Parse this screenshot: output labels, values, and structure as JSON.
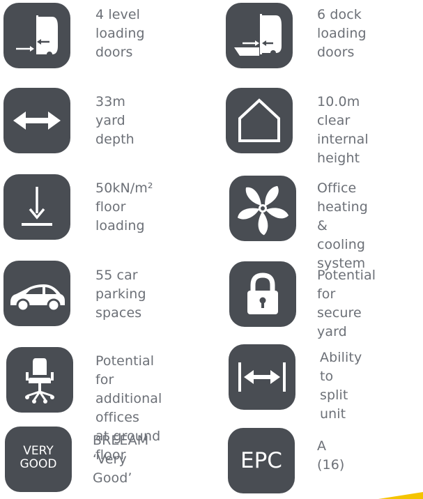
{
  "features": {
    "f1": {
      "label": "4 level\nloading\ndoors",
      "icon": "loading-door-icon"
    },
    "f2": {
      "label": "6 dock\nloading\ndoors",
      "icon": "dock-door-icon"
    },
    "f3": {
      "label": "33m\nyard\ndepth",
      "icon": "double-arrow-icon"
    },
    "f4": {
      "label": "10.0m clear\ninternal\nheight",
      "icon": "house-outline-icon"
    },
    "f5": {
      "label": "50kN/m²\nfloor\nloading",
      "icon": "down-arrow-floor-icon"
    },
    "f6": {
      "label": "Office heating\n& cooling\nsystem",
      "icon": "fan-icon"
    },
    "f7": {
      "label": "55 car\nparking\nspaces",
      "icon": "car-icon"
    },
    "f8": {
      "label": "Potential\nfor secure\nyard",
      "icon": "padlock-icon"
    },
    "f9": {
      "label": "Potential for\nadditional offices\nat ground floor",
      "icon": "office-chair-icon"
    },
    "f10": {
      "label": "Ability\nto split\nunit",
      "icon": "split-arrow-icon"
    },
    "f11": {
      "label": "BREEAM\n‘Very Good’",
      "icon": "breeam-badge",
      "badge": "VERY\nGOOD"
    },
    "f12": {
      "label": "A (16)",
      "icon": "epc-badge",
      "badge": "EPC"
    }
  },
  "colors": {
    "tile": "#494d53",
    "text": "#6c7077",
    "icon": "#ffffff",
    "accent": "#f4c400"
  }
}
